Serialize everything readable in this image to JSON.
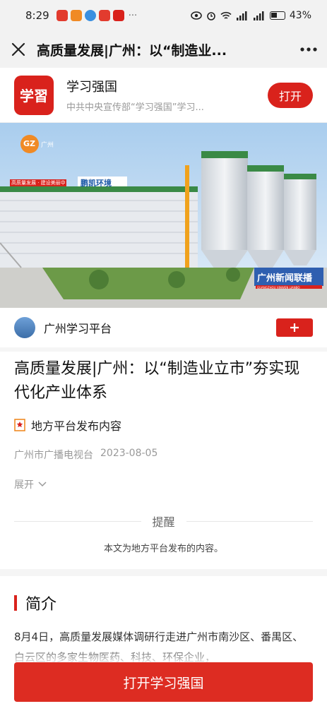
{
  "status_bar": {
    "time": "8:29",
    "more": "···",
    "battery": "43%",
    "app_colors": [
      "#e23b2e",
      "#f08a24",
      "#3a8fe0",
      "#e23b2e",
      "#d9221c"
    ]
  },
  "nav": {
    "title": "高质量发展|广州：以“制造业..."
  },
  "app_banner": {
    "logo_text": "学習",
    "name": "学习强国",
    "description": "中共中央宣传部“学习强国”学习...",
    "open_label": "打开"
  },
  "video": {
    "channel_logo": "GZ",
    "channel_logo_sub": "广州",
    "factory_sign": "鹏凯环境",
    "banner_slogan": "高质量发展 · 建设美丽中国",
    "news_caption": "广州新闻联播",
    "news_caption_sub": "GUANGZHOU XINWEN LIANBO"
  },
  "source": {
    "name": "广州学习平台",
    "follow_icon": "plus-icon"
  },
  "article": {
    "title": "高质量发展|广州：以“制造业立市”夯实现代化产业体系",
    "tag": "地方平台发布内容",
    "publisher": "广州市广播电视台",
    "date": "2023-08-05",
    "expand_label": "展开"
  },
  "reminder": {
    "title": "提醒",
    "body": "本文为地方平台发布的内容。"
  },
  "intro": {
    "title": "简介",
    "body": "8月4日，高质量发展媒体调研行走进广州市南沙区、番禺区、白云区的多家生物医药、科技、环保企业，"
  },
  "bottom_button": {
    "label": "打开学习强国"
  },
  "colors": {
    "brand_red": "#d9221c"
  }
}
